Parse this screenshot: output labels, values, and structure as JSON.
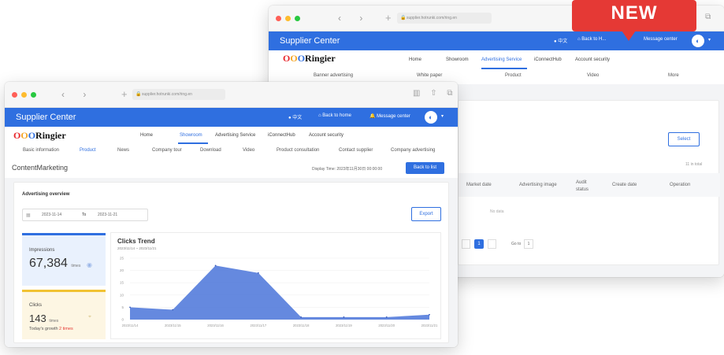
{
  "badge": {
    "label": "NEW"
  },
  "back": {
    "url": "supplier.hotrunki.com/ring.en",
    "app_title": "Supplier Center",
    "lang": "中文",
    "back_home": "Back to H...",
    "message_center": "Message center",
    "logo": {
      "mark": "OOO",
      "name": "Ringier"
    },
    "nav": [
      "Home",
      "Showroom",
      "Advertising Service",
      "iConnectHub",
      "Account security"
    ],
    "nav_active": "Advertising Service",
    "subnav": [
      "Banner advertising",
      "White paper",
      "Product",
      "Video",
      "More"
    ],
    "select_label": "Select",
    "total_text": "11 in total",
    "columns": [
      "Market date",
      "Advertising image",
      "Audit status",
      "Create date",
      "Operation"
    ],
    "empty_text": "No data",
    "pager": {
      "page": "1",
      "goto_label": "Go to",
      "goto_value": "1"
    }
  },
  "front": {
    "url": "supplier.hotrunki.com/ring.en",
    "app_title": "Supplier Center",
    "lang": "中文",
    "back_home": "Back to home",
    "message_center": "Message center",
    "logo": {
      "mark": "OOO",
      "name": "Ringier"
    },
    "nav": [
      "Home",
      "Showroom",
      "Advertising Service",
      "iConnectHub",
      "Account security"
    ],
    "nav_active": "Showroom",
    "subnav": [
      "Basic information",
      "Product",
      "News",
      "Company tour",
      "Download",
      "Video",
      "Product consultation",
      "Contact supplier",
      "Company advertising"
    ],
    "subnav_active": "Product",
    "page_title": "ContentMarketing",
    "display_time": "Display Time: 2023年11月30日 00:00:00",
    "back_to_list": "Back to list",
    "overview_title": "Advertising overview",
    "date_from": "2023-11-14",
    "date_to_label": "To",
    "date_to": "2023-11-21",
    "export_label": "Export",
    "impressions": {
      "label": "Impressions",
      "value": "67,384",
      "unit": "times"
    },
    "clicks": {
      "label": "Clicks",
      "value": "143",
      "unit": "times",
      "growth_prefix": "Today's growth",
      "growth_value": "2 times"
    }
  },
  "chart_data": {
    "type": "area",
    "title": "Clicks Trend",
    "subtitle": "2023/11/14 ~ 2023/11/21",
    "categories": [
      "2023/11/14",
      "2023/11/15",
      "2023/11/16",
      "2023/11/17",
      "2023/11/18",
      "2023/11/19",
      "2023/11/20",
      "2023/11/21"
    ],
    "values": [
      5,
      4,
      22,
      19,
      1,
      1,
      1,
      2
    ],
    "y_ticks": [
      0,
      5,
      10,
      15,
      20,
      25
    ],
    "ylim": [
      0,
      25
    ],
    "color": "#4a74d9"
  },
  "colors": {
    "primary": "#2f6fe0",
    "badge": "#e53935",
    "accent_yellow": "#f1c232",
    "growth": "#e53935"
  }
}
